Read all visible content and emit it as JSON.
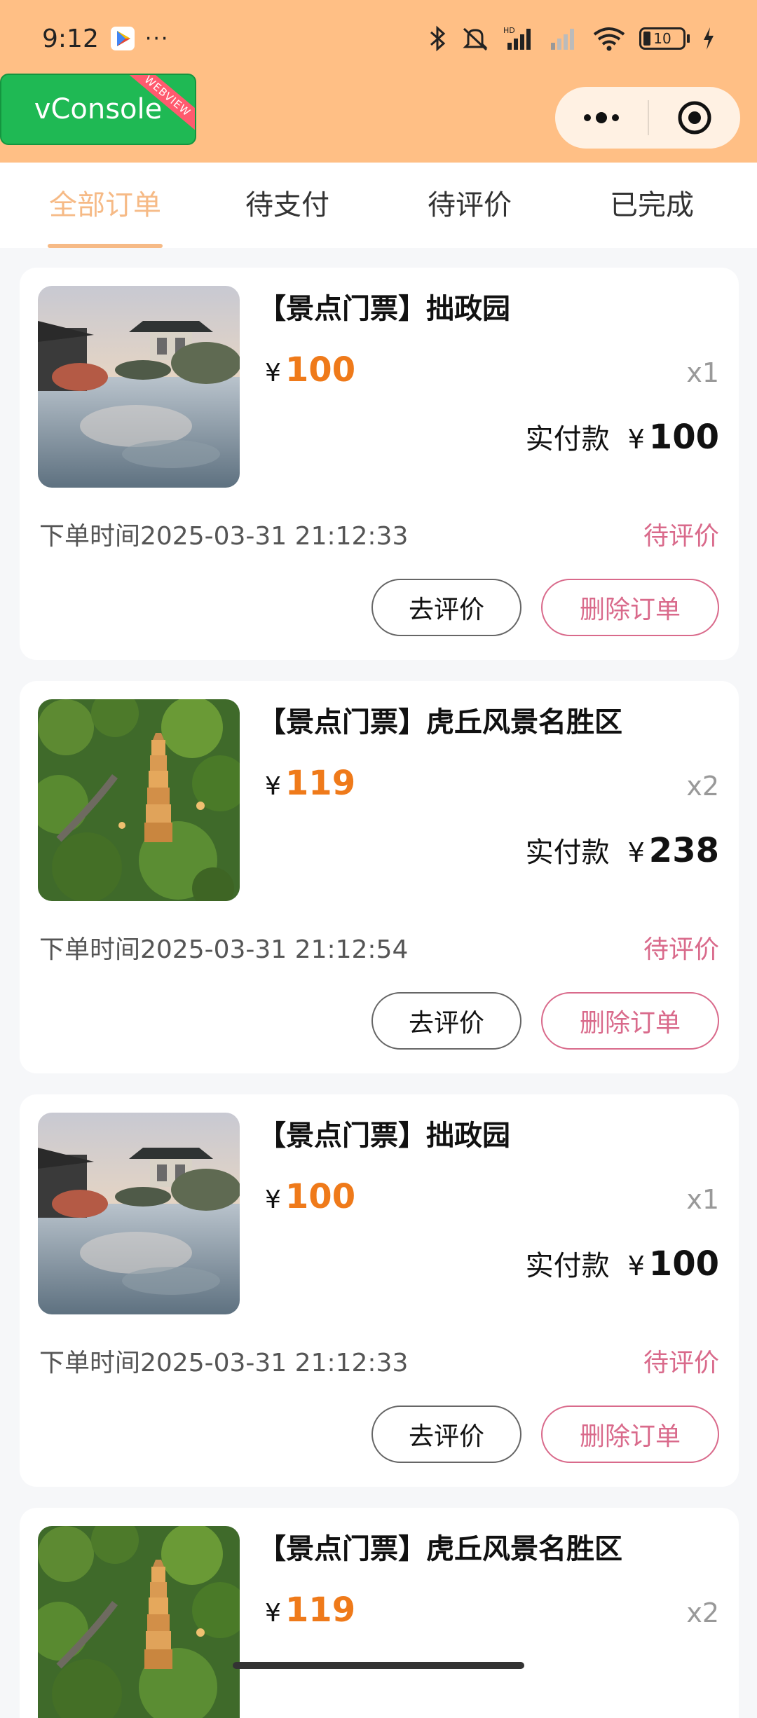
{
  "status_bar": {
    "time": "9:12",
    "more": "···",
    "battery": "10"
  },
  "vconsole": {
    "label": "vConsole",
    "ribbon": "WEBVIEW"
  },
  "tabs": [
    {
      "label": "全部订单",
      "active": true
    },
    {
      "label": "待支付",
      "active": false
    },
    {
      "label": "待评价",
      "active": false
    },
    {
      "label": "已完成",
      "active": false
    }
  ],
  "orders": [
    {
      "title": "【景点门票】拙政园",
      "currency": "¥",
      "price": "100",
      "qty": "x1",
      "paid_label": "实付款",
      "paid": "100",
      "time": "下单时间2025-03-31 21:12:33",
      "status": "待评价",
      "review_label": "去评价",
      "delete_label": "删除订单",
      "image": "garden-pavilion"
    },
    {
      "title": "【景点门票】虎丘风景名胜区",
      "currency": "¥",
      "price": "119",
      "qty": "x2",
      "paid_label": "实付款",
      "paid": "238",
      "time": "下单时间2025-03-31 21:12:54",
      "status": "待评价",
      "review_label": "去评价",
      "delete_label": "删除订单",
      "image": "pagoda-forest"
    },
    {
      "title": "【景点门票】拙政园",
      "currency": "¥",
      "price": "100",
      "qty": "x1",
      "paid_label": "实付款",
      "paid": "100",
      "time": "下单时间2025-03-31 21:12:33",
      "status": "待评价",
      "review_label": "去评价",
      "delete_label": "删除订单",
      "image": "garden-pavilion"
    },
    {
      "title": "【景点门票】虎丘风景名胜区",
      "currency": "¥",
      "price": "119",
      "qty": "x2",
      "image": "pagoda-forest"
    }
  ],
  "colors": {
    "header": "#ffbf85",
    "accent": "#f6ba86",
    "price": "#ef7a1a",
    "status": "#d96a8b"
  }
}
